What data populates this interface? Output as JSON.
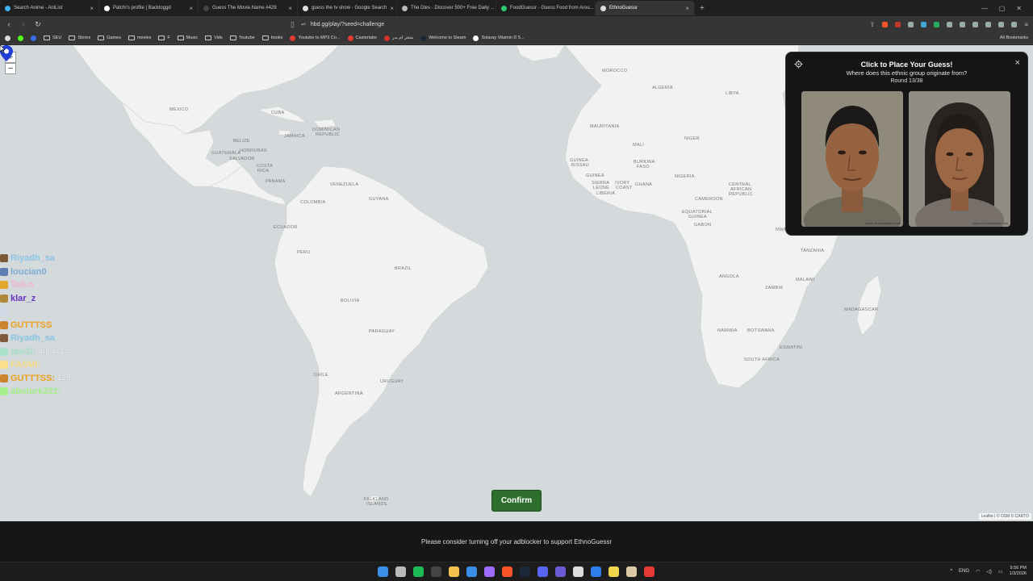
{
  "browser": {
    "tabs": [
      {
        "title": "Search Anime - AniList",
        "color": "#3db4f2"
      },
      {
        "title": "Patchi's profile | Backloggd",
        "color": "#ffffff"
      },
      {
        "title": "Guess The Movie.Name #429",
        "color": "#444444"
      },
      {
        "title": "guess the tv show - Google Search",
        "color": "#e0e0e0"
      },
      {
        "title": "The Dles - Discover 500+ Free Daily ...",
        "color": "#bbbbbb"
      },
      {
        "title": "FoodGuessr - Guess Food from Arou...",
        "color": "#2ecc71"
      },
      {
        "title": "EthnoGuessr",
        "color": "#dddddd"
      }
    ],
    "active_tab": 6,
    "url": "hbd.gg/play/?seed=challenge",
    "bookmarks": [
      {
        "label": "SEU",
        "kind": "folder"
      },
      {
        "label": "Stores",
        "kind": "folder"
      },
      {
        "label": "Games",
        "kind": "folder"
      },
      {
        "label": "movies",
        "kind": "folder"
      },
      {
        "label": "F",
        "kind": "folder"
      },
      {
        "label": "Music",
        "kind": "folder"
      },
      {
        "label": "Vids",
        "kind": "folder"
      },
      {
        "label": "Youtube",
        "kind": "folder"
      },
      {
        "label": "books",
        "kind": "folder"
      },
      {
        "label": "Youtube to MP3 Co...",
        "kind": "site",
        "color": "#e53935"
      },
      {
        "label": "Casterlabs",
        "kind": "site",
        "color": "#e53935"
      },
      {
        "label": "متجر ام بدر",
        "kind": "site",
        "color": "#d32f2f"
      },
      {
        "label": "Welcome to Steam",
        "kind": "site",
        "color": "#1b2838"
      },
      {
        "label": "Solaray Vitamin D 5...",
        "kind": "site",
        "color": "#ffffff"
      }
    ],
    "all_bookmarks": "All Bookmarks"
  },
  "map": {
    "labels": [
      {
        "t": "MEXICO"
      },
      {
        "t": "CUBA"
      },
      {
        "t": "DOMINICAN"
      },
      {
        "t": "REPUBLIC"
      },
      {
        "t": "JAMAICA"
      },
      {
        "t": "BELIZE"
      },
      {
        "t": "HONDURAS"
      },
      {
        "t": "GUATEMALA"
      },
      {
        "t": "SALVADOR"
      },
      {
        "t": "COSTA"
      },
      {
        "t": "RICA"
      },
      {
        "t": "PANAMA"
      },
      {
        "t": "VENEZUELA"
      },
      {
        "t": "GUYANA"
      },
      {
        "t": "COLOMBIA"
      },
      {
        "t": "ECUADOR"
      },
      {
        "t": "PERU"
      },
      {
        "t": "BRAZIL"
      },
      {
        "t": "BOLIVIA"
      },
      {
        "t": "PARAGUAY"
      },
      {
        "t": "CHILE"
      },
      {
        "t": "URUGUAY"
      },
      {
        "t": "ARGENTINA"
      },
      {
        "t": "FALKLAND"
      },
      {
        "t": "ISLANDS"
      },
      {
        "t": "MOROCCO"
      },
      {
        "t": "ALGERIA"
      },
      {
        "t": "LIBYA"
      },
      {
        "t": "MAURITANIA"
      },
      {
        "t": "MALI"
      },
      {
        "t": "NIGER"
      },
      {
        "t": "GUINEA-"
      },
      {
        "t": "BISSAU"
      },
      {
        "t": "GUINEA"
      },
      {
        "t": "BURKINA"
      },
      {
        "t": "FASO"
      },
      {
        "t": "SIERRA"
      },
      {
        "t": "LEONE"
      },
      {
        "t": "LIBERIA"
      },
      {
        "t": "IVORY"
      },
      {
        "t": "COAST"
      },
      {
        "t": "GHANA"
      },
      {
        "t": "NIGERIA"
      },
      {
        "t": "CAMEROON"
      },
      {
        "t": "EQUATORIAL"
      },
      {
        "t": "GUINEA"
      },
      {
        "t": "GABON"
      },
      {
        "t": "CENTRAL"
      },
      {
        "t": "AFRICAN"
      },
      {
        "t": "REPUBLIC"
      },
      {
        "t": "TANZANIA"
      },
      {
        "t": "ANGOLA"
      },
      {
        "t": "ZAMBIA"
      },
      {
        "t": "MALAWI"
      },
      {
        "t": "MADAGASCAR"
      },
      {
        "t": "NAMIBIA"
      },
      {
        "t": "BOTSWANA"
      },
      {
        "t": "ESWATINI"
      },
      {
        "t": "SOUTH AFRICA"
      },
      {
        "t": "RWA"
      }
    ],
    "zoom_in": "+",
    "zoom_out": "−",
    "attribution": "Leaflet | © OSM © CARTO",
    "confirm_label": "Confirm"
  },
  "panel": {
    "title": "Click to Place Your Guess!",
    "subtitle": "Where does this ethnic group originate from?",
    "round": "Round 13/38",
    "close": "×",
    "face_watermark": "faces-of-humankind.com"
  },
  "chat": [
    {
      "user": "Riyadh_sa",
      "msg": "",
      "color": "#8ec9ea",
      "badge": "#7d5a3a"
    },
    {
      "user": "loucian0",
      "msg": "",
      "color": "#7fb0d8",
      "badge": "#5d7db3"
    },
    {
      "user": "Toli.n",
      "msg": "",
      "color": "#f8b6cd",
      "badge": "#e1a62b"
    },
    {
      "user": "klar_z",
      "msg": "",
      "color": "#6c37c6",
      "badge": "#b08a3a"
    },
    {
      "user": "",
      "msg": "",
      "color": "#c9d9f3",
      "badge": "#cfd8e6"
    },
    {
      "user": "GUTTTSS",
      "msg": "",
      "color": "#f2a521",
      "badge": "#c9842d"
    },
    {
      "user": "Riyadh_sa",
      "msg": "",
      "color": "#8ec9ea",
      "badge": "#7d5a3a"
    },
    {
      "user": "taw2i:",
      "msg": "antarctica",
      "color": "#a8e3c9",
      "badge": "#a8e3c9"
    },
    {
      "user": "FASMI:",
      "msg": "",
      "color": "#ffe08a",
      "badge": "#ffe08a"
    },
    {
      "user": "GUTTTSS:",
      "msg": "120",
      "color": "#f2a521",
      "badge": "#c9842d"
    },
    {
      "user": "abuturk222:",
      "msg": "",
      "color": "#a8f08c",
      "badge": "#a8f08c"
    }
  ],
  "footer": {
    "text": "Please consider turning off your adblocker to support EthnoGuessr"
  },
  "taskbar": {
    "icons": [
      {
        "name": "windows-start-icon",
        "color": "#3a8ee6"
      },
      {
        "name": "search-icon",
        "color": "#bbbbbb"
      },
      {
        "name": "spotify-icon",
        "color": "#1db954"
      },
      {
        "name": "app-icon",
        "color": "#444444"
      },
      {
        "name": "file-explorer-icon",
        "color": "#f2c14e"
      },
      {
        "name": "todo-icon",
        "color": "#3a8ee6"
      },
      {
        "name": "pen-icon",
        "color": "#9b6cff"
      },
      {
        "name": "brave-icon",
        "color": "#fb542b"
      },
      {
        "name": "steam-icon",
        "color": "#1b2838"
      },
      {
        "name": "discord-icon",
        "color": "#5865f2"
      },
      {
        "name": "obs-icon",
        "color": "#6b5bd2"
      },
      {
        "name": "github-icon",
        "color": "#dddddd"
      },
      {
        "name": "globe-icon",
        "color": "#2f80ed"
      },
      {
        "name": "notes-icon",
        "color": "#f2d64e"
      },
      {
        "name": "app2-icon",
        "color": "#d9c9a7"
      },
      {
        "name": "record-icon",
        "color": "#e53935"
      }
    ],
    "lang": "ENG",
    "time": "9:56 PM",
    "date": "1/3/2026"
  }
}
